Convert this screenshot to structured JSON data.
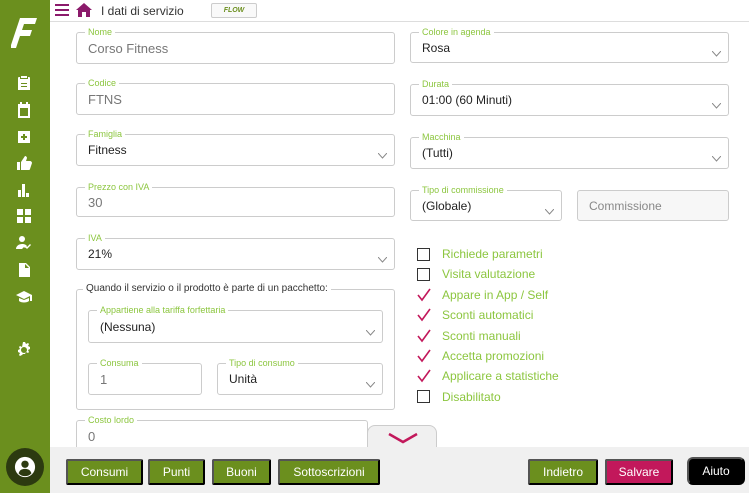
{
  "topbar": {
    "breadcrumb": "I dati di servizio",
    "brand": "FLOW"
  },
  "form": {
    "nome": {
      "label": "Nome",
      "value": "Corso Fitness"
    },
    "colore": {
      "label": "Colore in agenda",
      "value": "Rosa"
    },
    "codice": {
      "label": "Codice",
      "value": "FTNS"
    },
    "durata": {
      "label": "Durata",
      "value": "01:00 (60 Minuti)"
    },
    "famiglia": {
      "label": "Famiglia",
      "value": "Fitness"
    },
    "macchina": {
      "label": "Macchina",
      "value": "(Tutti)"
    },
    "prezzo": {
      "label": "Prezzo con IVA",
      "value": "30"
    },
    "tipo_commissione": {
      "label": "Tipo di commissione",
      "value": "(Globale)"
    },
    "commissione": {
      "placeholder": "Commissione"
    },
    "iva": {
      "label": "IVA",
      "value": "21%"
    },
    "pacchetto": {
      "legend": "Quando il servizio o il prodotto è parte di un pacchetto:",
      "tariffa": {
        "label": "Appartiene alla tariffa forfettaria",
        "value": "(Nessuna)"
      },
      "consuma": {
        "label": "Consuma",
        "value": "1"
      },
      "tipo_consumo": {
        "label": "Tipo di consumo",
        "value": "Unità"
      }
    },
    "costo_lordo": {
      "label": "Costo lordo",
      "value": "0"
    }
  },
  "checkboxes": [
    {
      "label": "Richiede parametri",
      "checked": false
    },
    {
      "label": "Visita valutazione",
      "checked": false
    },
    {
      "label": "Appare in App / Self",
      "checked": true
    },
    {
      "label": "Sconti automatici",
      "checked": true
    },
    {
      "label": "Sconti manuali",
      "checked": true
    },
    {
      "label": "Accetta promozioni",
      "checked": true
    },
    {
      "label": "Applicare a statistiche",
      "checked": true
    },
    {
      "label": "Disabilitato",
      "checked": false
    }
  ],
  "buttons": {
    "consumi": "Consumi",
    "punti": "Punti",
    "buoni": "Buoni",
    "sottoscrizioni": "Sottoscrizioni",
    "indietro": "Indietro",
    "salvare": "Salvare",
    "aiuto": "Aiuto"
  },
  "colors": {
    "sidebar": "#6b8f1e",
    "accent_label": "#8cc63f",
    "check": "#c2185b",
    "save": "#c2185b"
  },
  "sidebar_icons": [
    "clipboard-icon",
    "calendar-icon",
    "add-box-icon",
    "thumbs-up-icon",
    "bar-chart-icon",
    "dashboard-icon",
    "person-check-icon",
    "document-icon",
    "school-icon",
    "settings-icon"
  ]
}
